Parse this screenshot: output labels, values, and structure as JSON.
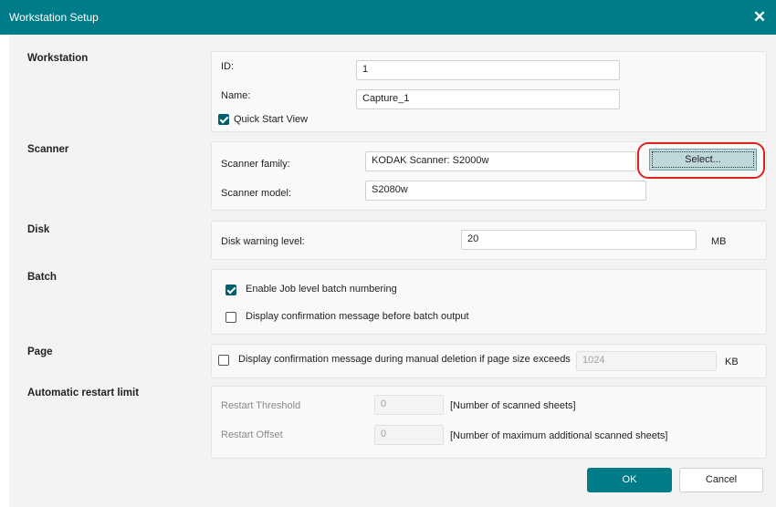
{
  "window": {
    "title": "Workstation Setup",
    "close_glyph": "✕"
  },
  "sections": {
    "workstation": {
      "heading": "Workstation",
      "id_label": "ID:",
      "id_value": "1",
      "name_label": "Name:",
      "name_value": "Capture_1",
      "quick_start_label": "Quick Start View",
      "quick_start_checked": true
    },
    "scanner": {
      "heading": "Scanner",
      "family_label": "Scanner family:",
      "family_value": "KODAK Scanner: S2000w",
      "model_label": "Scanner model:",
      "model_value": "S2080w",
      "select_label": "Select..."
    },
    "disk": {
      "heading": "Disk",
      "warning_label": "Disk warning level:",
      "warning_value": "20",
      "unit": "MB"
    },
    "batch": {
      "heading": "Batch",
      "job_numbering_label": "Enable Job level batch numbering",
      "job_numbering_checked": true,
      "confirm_output_label": "Display confirmation message before batch output",
      "confirm_output_checked": false
    },
    "page": {
      "heading": "Page",
      "manual_deletion_label": "Display confirmation message during manual deletion if page size exceeds",
      "manual_deletion_checked": false,
      "size_value": "1024",
      "unit": "KB"
    },
    "restart": {
      "heading": "Automatic restart limit",
      "threshold_label": "Restart Threshold",
      "threshold_value": "0",
      "threshold_desc": "[Number of scanned sheets]",
      "offset_label": "Restart Offset",
      "offset_value": "0",
      "offset_desc": "[Number of maximum additional scanned sheets]"
    }
  },
  "buttons": {
    "ok": "OK",
    "cancel": "Cancel"
  },
  "colors": {
    "titlebar": "#007c89",
    "accent": "#005f6b",
    "highlight": "#d9231c"
  }
}
